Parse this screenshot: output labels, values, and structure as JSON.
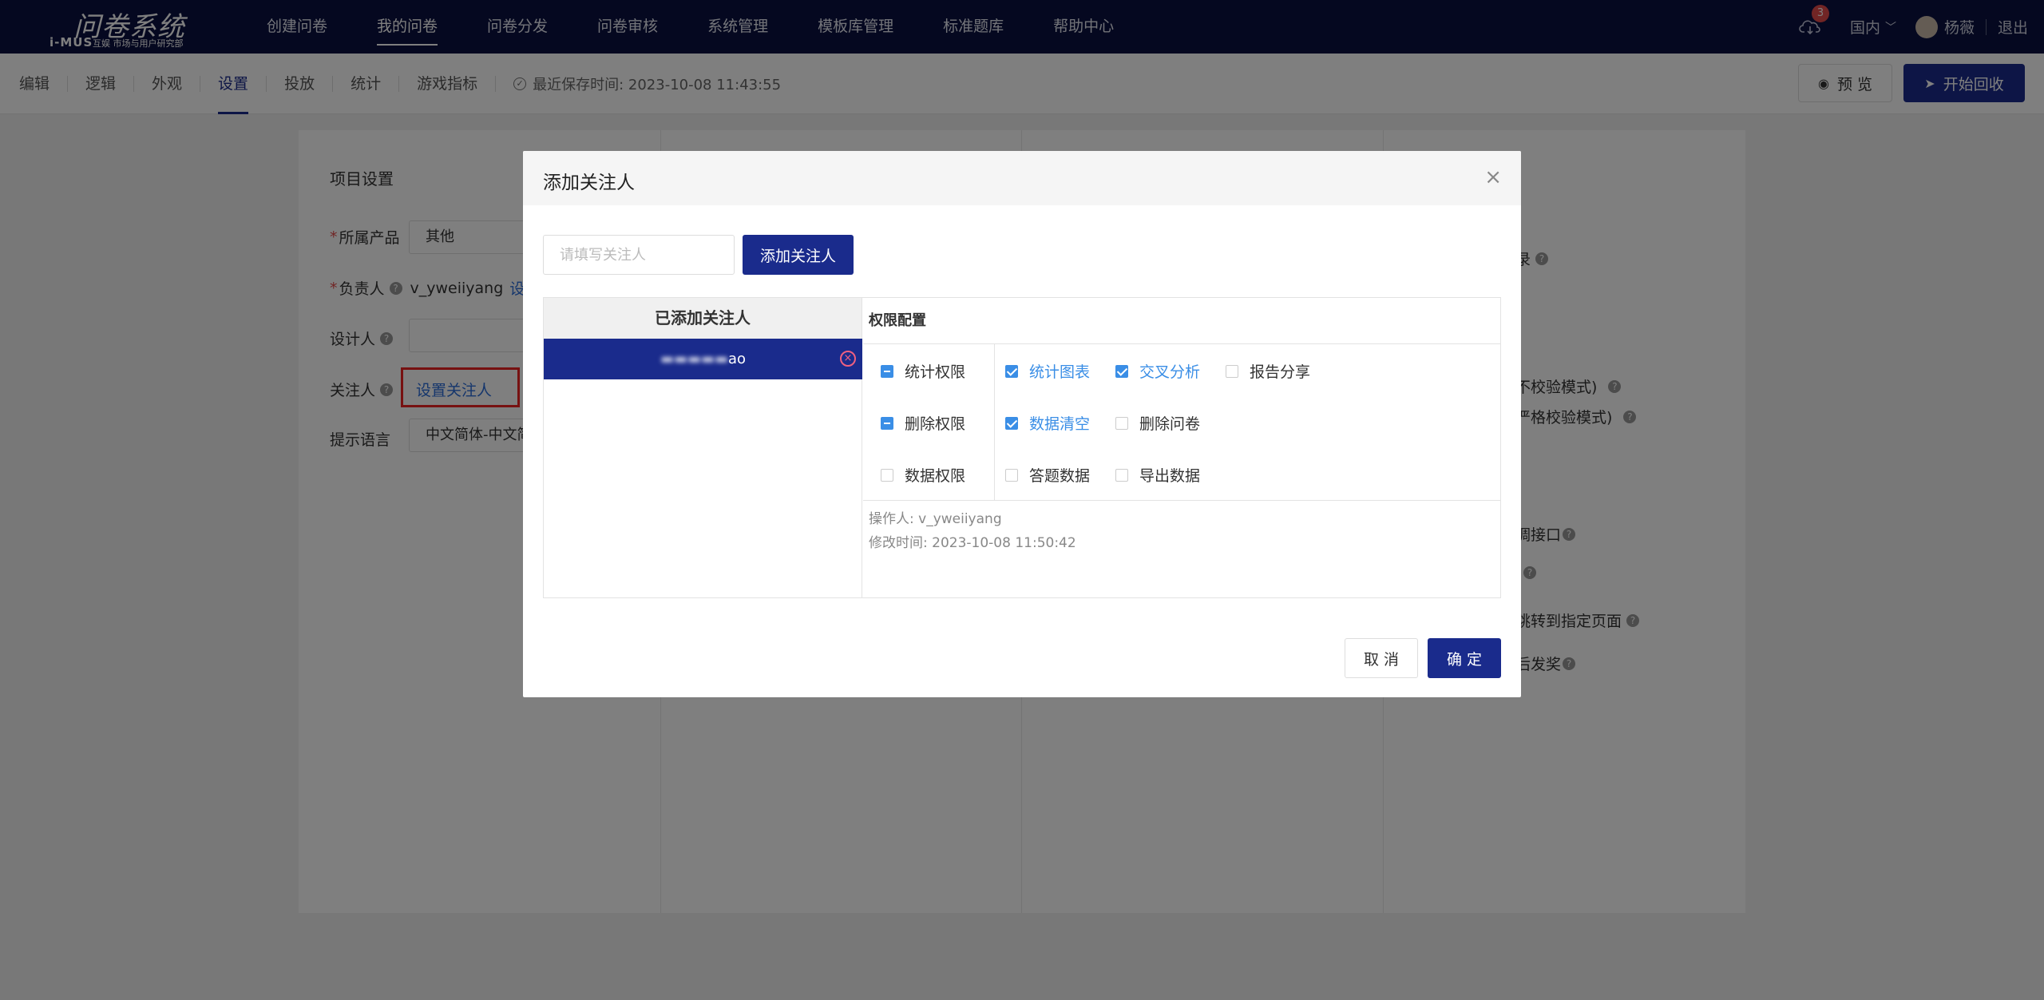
{
  "logo": {
    "title": "问卷系统",
    "mark": "i-MUS",
    "subtitle": "互娱 市场与用户研究部"
  },
  "topnav": {
    "items": [
      "创建问卷",
      "我的问卷",
      "问卷分发",
      "问卷审核",
      "系统管理",
      "模板库管理",
      "标准题库",
      "帮助中心"
    ],
    "active_index": 1,
    "badge_count": "3",
    "region": "国内",
    "username": "杨薇",
    "logout": "退出"
  },
  "subnav": {
    "tabs": [
      "编辑",
      "逻辑",
      "外观",
      "设置",
      "投放",
      "统计",
      "游戏指标"
    ],
    "active_index": 3,
    "save_time": "最近保存时间: 2023-10-08 11:43:55",
    "preview_label": "预 览",
    "start_label": "开始回收"
  },
  "project_settings": {
    "title": "项目设置",
    "product_label": "所属产品",
    "product_value": "其他",
    "owner_label": "负责人",
    "owner_value": "v_yweiiyang",
    "owner_link": "设置负",
    "designer_label": "设计人",
    "follower_label": "关注人",
    "follower_link": "设置关注人",
    "lang_label": "提示语言",
    "lang_value": "中文简体-中文简"
  },
  "right_fragments": [
    "录",
    "不校验模式)",
    "严格校验模式)",
    "调接口",
    "跳转到指定页面",
    "后发奖"
  ],
  "modal": {
    "title": "添加关注人",
    "close": "×",
    "input_placeholder": "请填写关注人",
    "add_button": "添加关注人",
    "added_header": "已添加关注人",
    "added_user_suffix": "ao",
    "perm_header": "权限配置",
    "permissions": {
      "stats": {
        "label": "统计权限",
        "state": "indeterminate"
      },
      "stats_chart": {
        "label": "统计图表",
        "checked": true
      },
      "cross_analysis": {
        "label": "交叉分析",
        "checked": true
      },
      "report_share": {
        "label": "报告分享",
        "checked": false
      },
      "delete": {
        "label": "删除权限",
        "state": "indeterminate"
      },
      "data_clear": {
        "label": "数据清空",
        "checked": true
      },
      "delete_survey": {
        "label": "删除问卷",
        "checked": false
      },
      "data": {
        "label": "数据权限",
        "state": "unchecked"
      },
      "answer_data": {
        "label": "答题数据",
        "checked": false
      },
      "export_data": {
        "label": "导出数据",
        "checked": false
      }
    },
    "operator": "操作人: v_yweiiyang",
    "modified": "修改时间: 2023-10-08 11:50:42",
    "cancel": "取 消",
    "ok": "确 定"
  },
  "colors": {
    "nav_bg": "#0a1140",
    "primary": "#1a2b8c",
    "check_blue": "#3a8ee6",
    "highlight_red": "#e22222"
  }
}
